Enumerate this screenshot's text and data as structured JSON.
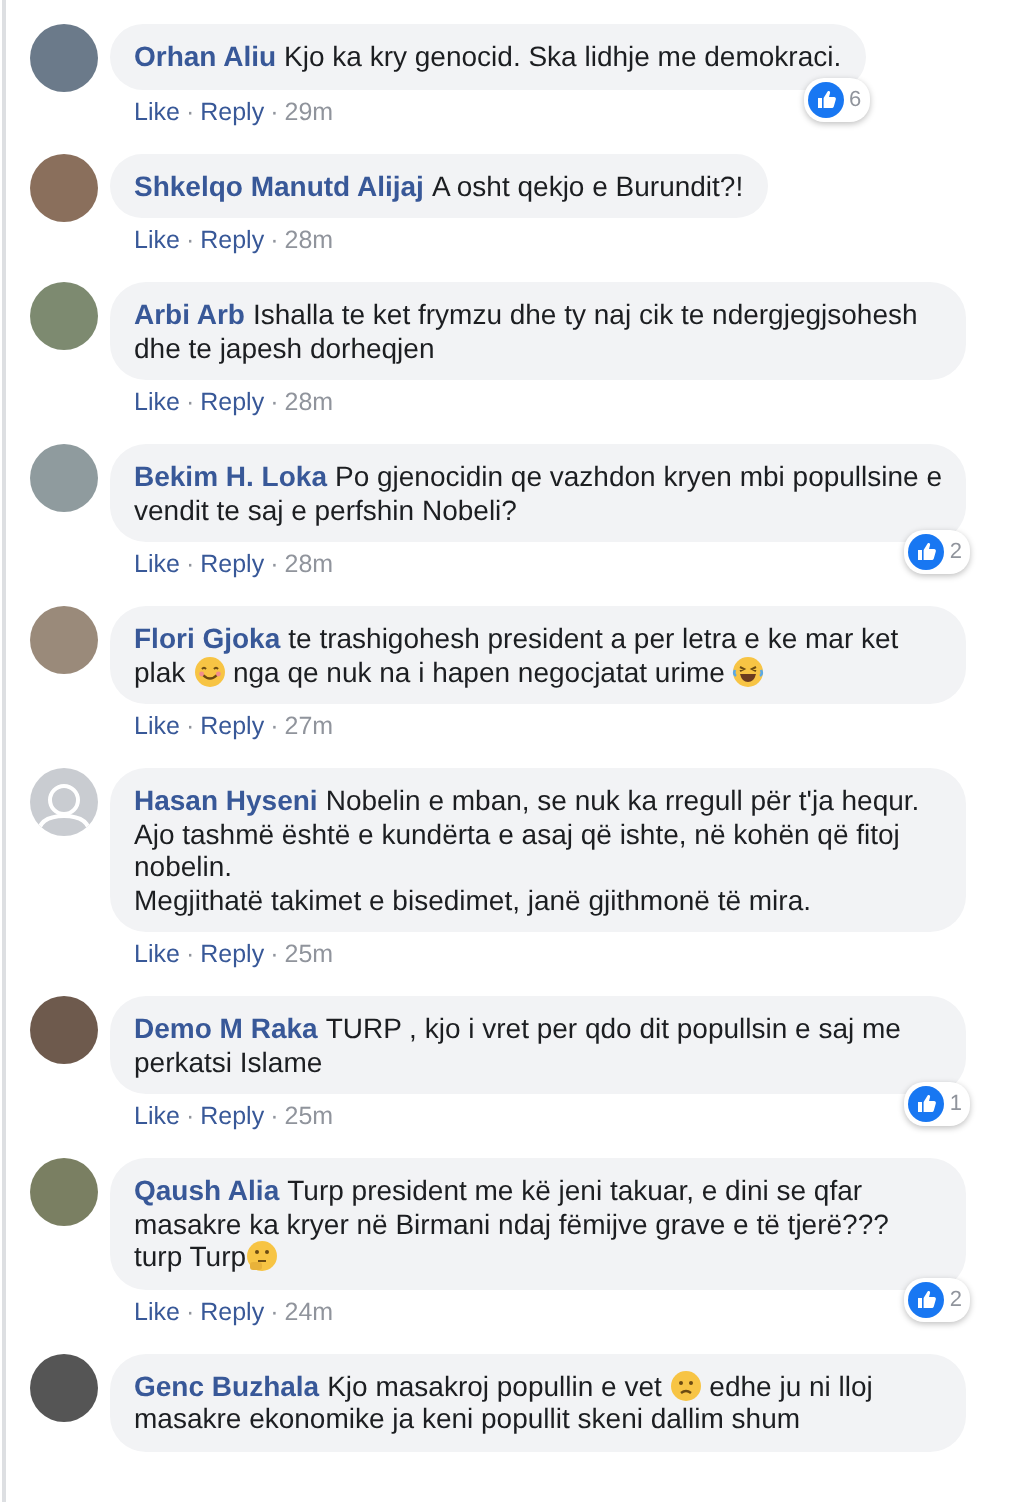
{
  "comments": [
    {
      "author": "Orhan Aliu",
      "avatar": {
        "kind": "photo"
      },
      "body": [
        {
          "kind": "text",
          "text": "Kjo ka kry genocid. Ska lidhje me demokraci."
        }
      ],
      "actions": [
        {
          "kind": "link",
          "text": "Like"
        },
        {
          "kind": "separator",
          "text": "·"
        },
        {
          "kind": "link",
          "text": "Reply"
        },
        {
          "kind": "separator",
          "text": "·"
        },
        {
          "kind": "time",
          "text": "29m"
        }
      ],
      "likes": "6"
    },
    {
      "author": "Shkelqo Manutd Alijaj",
      "avatar": {
        "kind": "photo"
      },
      "body": [
        {
          "kind": "text",
          "text": "A osht qekjo e Burundit?!"
        }
      ],
      "actions": [
        {
          "kind": "link",
          "text": "Like"
        },
        {
          "kind": "separator",
          "text": "·"
        },
        {
          "kind": "link",
          "text": "Reply"
        },
        {
          "kind": "separator",
          "text": "·"
        },
        {
          "kind": "time",
          "text": "28m"
        }
      ]
    },
    {
      "author": "Arbi Arb",
      "avatar": {
        "kind": "photo"
      },
      "body": [
        {
          "kind": "text",
          "text": "Ishalla te ket frymzu dhe ty naj cik te ndergjegjsohesh dhe te japesh dorheqjen"
        }
      ],
      "actions": [
        {
          "kind": "link",
          "text": "Like"
        },
        {
          "kind": "separator",
          "text": "·"
        },
        {
          "kind": "link",
          "text": "Reply"
        },
        {
          "kind": "separator",
          "text": "·"
        },
        {
          "kind": "time",
          "text": "28m"
        }
      ]
    },
    {
      "author": "Bekim H. Loka",
      "avatar": {
        "kind": "photo"
      },
      "body": [
        {
          "kind": "text",
          "text": "Po gjenocidin qe vazhdon kryen mbi popullsine e vendit te saj e perfshin Nobeli?"
        }
      ],
      "actions": [
        {
          "kind": "link",
          "text": "Like"
        },
        {
          "kind": "separator",
          "text": "·"
        },
        {
          "kind": "link",
          "text": "Reply"
        },
        {
          "kind": "separator",
          "text": "·"
        },
        {
          "kind": "time",
          "text": "28m"
        }
      ],
      "likes": "2"
    },
    {
      "author": "Flori Gjoka",
      "avatar": {
        "kind": "photo"
      },
      "body": [
        {
          "kind": "text",
          "text": "te trashigohesh president a per letra e ke mar ket plak "
        },
        {
          "kind": "smile"
        },
        {
          "kind": "text",
          "text": " nga qe nuk na i hapen negocjatat urime "
        },
        {
          "kind": "laugh"
        }
      ],
      "actions": [
        {
          "kind": "link",
          "text": "Like"
        },
        {
          "kind": "separator",
          "text": "·"
        },
        {
          "kind": "link",
          "text": "Reply"
        },
        {
          "kind": "separator",
          "text": "·"
        },
        {
          "kind": "time",
          "text": "27m"
        }
      ]
    },
    {
      "author": "Hasan Hyseni",
      "avatar": {
        "kind": "default"
      },
      "body": [
        {
          "kind": "text",
          "text": "Nobelin e mban, se nuk ka rregull për t'ja hequr.\nAjo tashmë është e kundërta e asaj që ishte, në kohën që fitoj nobelin.\nMegjithatë takimet e bisedimet, janë gjithmonë të mira."
        }
      ],
      "actions": [
        {
          "kind": "link",
          "text": "Like"
        },
        {
          "kind": "separator",
          "text": "·"
        },
        {
          "kind": "link",
          "text": "Reply"
        },
        {
          "kind": "separator",
          "text": "·"
        },
        {
          "kind": "time",
          "text": "25m"
        }
      ]
    },
    {
      "author": "Demo M Raka",
      "avatar": {
        "kind": "photo"
      },
      "body": [
        {
          "kind": "text",
          "text": "TURP , kjo i vret per qdo dit popullsin e saj me perkatsi Islame"
        }
      ],
      "actions": [
        {
          "kind": "link",
          "text": "Like"
        },
        {
          "kind": "separator",
          "text": "·"
        },
        {
          "kind": "link",
          "text": "Reply"
        },
        {
          "kind": "separator",
          "text": "·"
        },
        {
          "kind": "time",
          "text": "25m"
        }
      ],
      "likes": "1"
    },
    {
      "author": "Qaush Alia",
      "avatar": {
        "kind": "photo"
      },
      "body": [
        {
          "kind": "text",
          "text": "Turp president me kë jeni takuar, e dini se qfar masakre ka kryer në Birmani ndaj fëmijve grave e të tjerë??? turp Turp"
        },
        {
          "kind": "think"
        }
      ],
      "actions": [
        {
          "kind": "link",
          "text": "Like"
        },
        {
          "kind": "separator",
          "text": "·"
        },
        {
          "kind": "link",
          "text": "Reply"
        },
        {
          "kind": "separator",
          "text": "·"
        },
        {
          "kind": "time",
          "text": "24m"
        }
      ],
      "likes": "2"
    },
    {
      "author": "Genc Buzhala",
      "avatar": {
        "kind": "photo"
      },
      "body": [
        {
          "kind": "text",
          "text": "Kjo masakroj popullin e vet "
        },
        {
          "kind": "frown"
        },
        {
          "kind": "text",
          "text": " edhe ju ni lloj masakre ekonomike ja keni popullit skeni dallim shum"
        }
      ]
    }
  ]
}
